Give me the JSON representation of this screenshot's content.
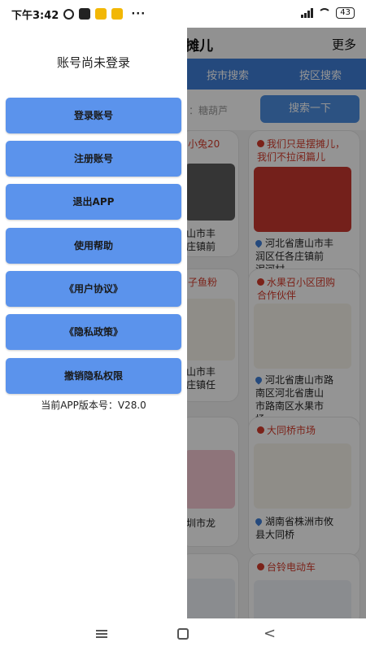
{
  "status_bar": {
    "time": "下午3:42",
    "more": "···",
    "battery": "43"
  },
  "app": {
    "title": "摊儿",
    "more": "更多",
    "tabs": [
      "按市搜索",
      "按区搜索"
    ],
    "search_placeholder": "糖葫芦",
    "search_button": "搜索一下",
    "cards": [
      {
        "title": "小兔20",
        "location": "山市丰\n庄镇前"
      },
      {
        "title": "我们只是摆摊儿，\n我们不拉闲篇儿",
        "location": "河北省唐山市丰\n润区任各庄镇前\n泥河村"
      },
      {
        "title": "子鱼粉",
        "location": "山市丰\n庄镇任"
      },
      {
        "title": "水果召小区团购\n合作伙伴",
        "location": "河北省唐山市路\n南区河北省唐山\n市路南区水果市\n场"
      },
      {
        "title": "",
        "location": "圳市龙"
      },
      {
        "title": "大同桥市场",
        "location": "湖南省株洲市攸\n县大同桥"
      },
      {
        "title": "",
        "location": ""
      },
      {
        "title": "台铃电动车",
        "location": ""
      }
    ]
  },
  "drawer": {
    "title": "账号尚未登录",
    "buttons": [
      "登录账号",
      "注册账号",
      "退出APP",
      "使用帮助",
      "《用户协议》",
      "《隐私政策》",
      "撤销隐私权限"
    ],
    "version": "当前APP版本号：V28.0"
  },
  "accent_color": "#5b93ec",
  "tab_bar_color": "#3f7fd8"
}
